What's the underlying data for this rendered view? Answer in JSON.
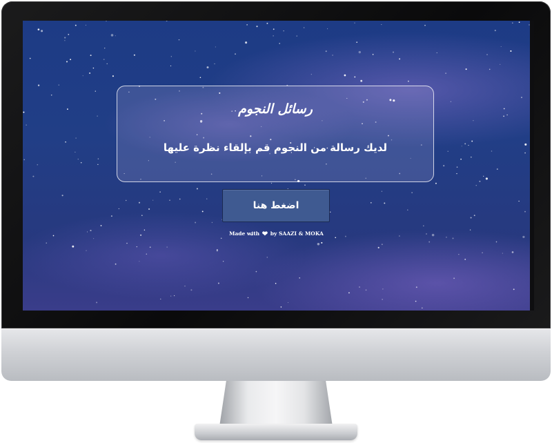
{
  "card": {
    "title": "رسائل النجوم",
    "message": "لديك رسالة من النجوم قم بإلقاء نظرة عليها"
  },
  "button": {
    "label": "اضغط هنا"
  },
  "credit": {
    "prefix": "Made with",
    "heart": "❤",
    "suffix": "by SAAZI & MOKA"
  },
  "colors": {
    "sky": "#213e86",
    "button": "#3f5a91",
    "text": "#ffffff"
  }
}
